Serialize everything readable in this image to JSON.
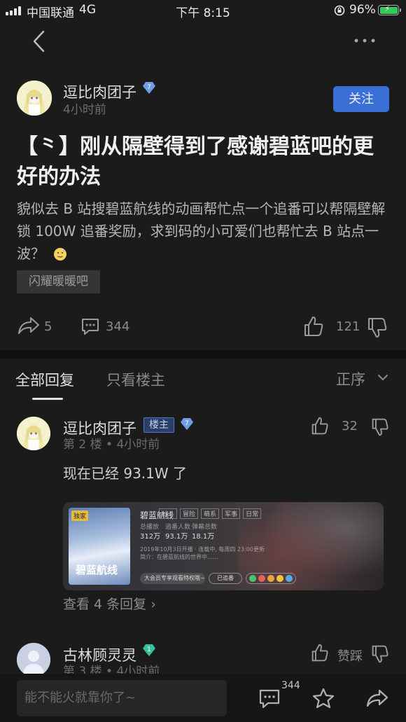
{
  "status_bar": {
    "carrier": "中国联通",
    "network": "4G",
    "time": "下午 8:15",
    "battery": "96%"
  },
  "post": {
    "author": "逗比肉团子",
    "time_ago": "4小时前",
    "follow_label": "关注",
    "title": "【⺀】刚从隔壁得到了感谢碧蓝吧的更好的办法",
    "body": "貌似去 B 站搜碧蓝航线的动画帮忙点一个追番可以帮隔壁解锁 100W 追番奖励，求到码的小可爱们也帮忙去 B 站点一波？",
    "tag": "闪耀暖暖吧",
    "share_count": "5",
    "comment_count": "344",
    "like_count": "121"
  },
  "tabs": {
    "all": "全部回复",
    "op_only": "只看楼主",
    "sort": "正序"
  },
  "replies": [
    {
      "author": "逗比肉团子",
      "badge": "楼主",
      "floor": "第 2 楼",
      "time_ago": "4小时前",
      "likes": "32",
      "text": "现在已经 93.1W 了",
      "more": "查看 4 条回复 ›",
      "preview": {
        "exclusive": "独家",
        "poster_title": "碧蓝航线",
        "title": "碧蓝航线",
        "chips": [
          "战斗",
          "冒险",
          "萌系",
          "军事",
          "日常"
        ],
        "stats": [
          {
            "label": "总播放",
            "value": "312万"
          },
          {
            "label": "追番人数",
            "value": "93.1万"
          },
          {
            "label": "弹幕总数",
            "value": "18.1万"
          }
        ],
        "desc": "2019年10月3日开播 · 连载中, 每周四 23:00更新",
        "desc2": "简介：在碧蓝航线的世界中……",
        "vip": "大会员专享观看特权哦~",
        "followed": "已追番"
      }
    },
    {
      "author": "古林顾灵灵",
      "floor": "第 3 楼",
      "time_ago": "4小时前",
      "like_label": "赞踩"
    }
  ],
  "bottom": {
    "placeholder": "能不能火就靠你了~",
    "comment_count": "344"
  },
  "colors": {
    "background": "#1b1b1c",
    "accent": "#3a70d6",
    "verified": "#6f9ee8",
    "diamond": "#36c19a"
  }
}
